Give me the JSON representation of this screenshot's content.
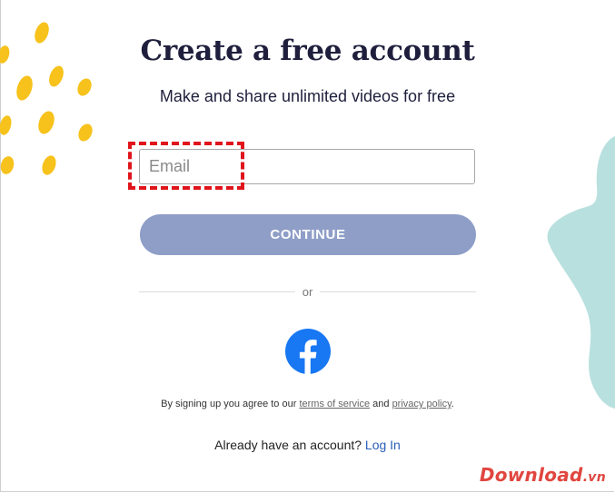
{
  "signup": {
    "title": "Create a free account",
    "subtitle": "Make and share unlimited videos for free",
    "email_placeholder": "Email",
    "continue_label": "CONTINUE",
    "divider_text": "or",
    "facebook_icon": "facebook-icon",
    "terms_prefix": "By signing up you agree to our",
    "terms_link": "terms of service",
    "terms_and": "and",
    "privacy_link": "privacy policy",
    "terms_suffix": ".",
    "login_prompt": "Already have an account?",
    "login_link": "Log In"
  },
  "watermark": {
    "brand": "Download",
    "tld": ".vn"
  },
  "colors": {
    "button": "#8e9ec7",
    "facebook": "#1877f2",
    "highlight": "#e0141b",
    "title": "#1f1f3d",
    "blob": "#b8e0df",
    "dots": "#f6c21b"
  }
}
